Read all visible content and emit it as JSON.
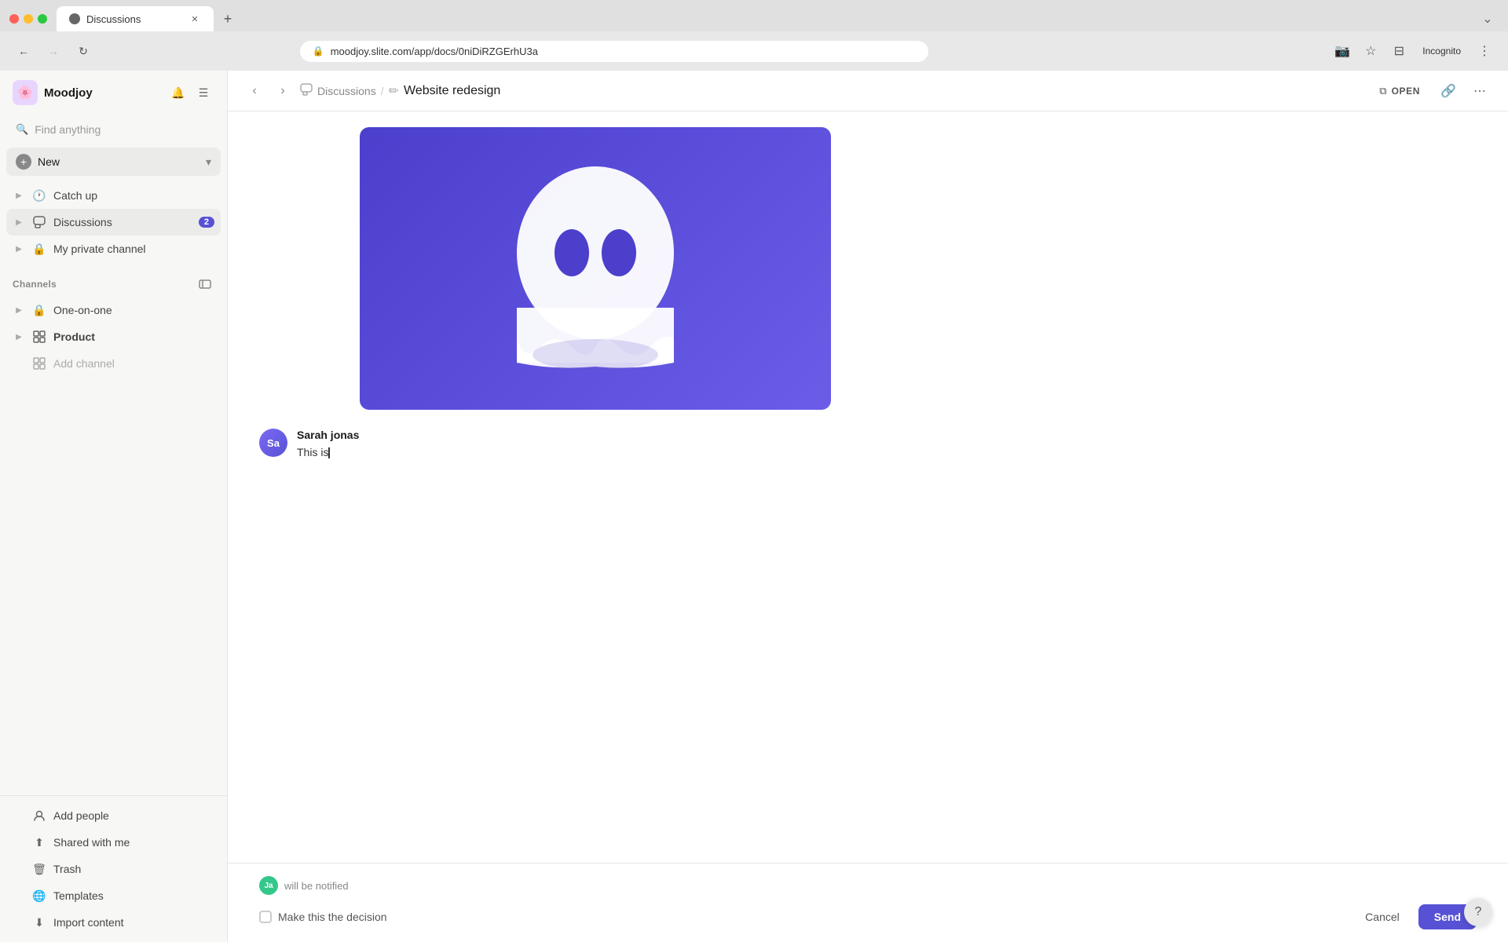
{
  "browser": {
    "tab_title": "Discussions",
    "url": "moodjoy.slite.com/app/docs/0niDiRZGErhU3a",
    "incognito_label": "Incognito"
  },
  "sidebar": {
    "workspace_name": "Moodjoy",
    "search_placeholder": "Find anything",
    "new_button_label": "New",
    "nav_items": [
      {
        "id": "catch-up",
        "icon": "🕐",
        "label": "Catch up",
        "badge": null
      },
      {
        "id": "discussions",
        "icon": "💬",
        "label": "Discussions",
        "badge": "2"
      },
      {
        "id": "my-private-channel",
        "icon": "🔒",
        "label": "My private channel",
        "badge": null
      }
    ],
    "channels_section": "Channels",
    "channel_items": [
      {
        "id": "one-on-one",
        "icon": "🔒",
        "label": "One-on-one"
      },
      {
        "id": "product",
        "icon": "⊞",
        "label": "Product"
      },
      {
        "id": "add-channel",
        "icon": "⊞",
        "label": "Add channel"
      }
    ],
    "footer_items": [
      {
        "id": "add-people",
        "icon": "👤",
        "label": "Add people"
      },
      {
        "id": "shared-with-me",
        "icon": "⬆",
        "label": "Shared with me"
      },
      {
        "id": "trash",
        "icon": "🗑",
        "label": "Trash"
      },
      {
        "id": "templates",
        "icon": "🌐",
        "label": "Templates"
      },
      {
        "id": "import-content",
        "icon": "⬇",
        "label": "Import content"
      }
    ]
  },
  "header": {
    "breadcrumb_parent": "Discussions",
    "breadcrumb_current": "Website redesign",
    "open_label": "OPEN",
    "parent_icon": "💬",
    "current_icon": "✏️"
  },
  "thread": {
    "author_name": "Sarah jonas",
    "author_initials": "Sa",
    "message_text": "This is",
    "notified_initials": "Ja",
    "notified_text": "will be notified"
  },
  "reply": {
    "decision_label": "Make this the decision",
    "cancel_label": "Cancel",
    "send_label": "Send"
  }
}
